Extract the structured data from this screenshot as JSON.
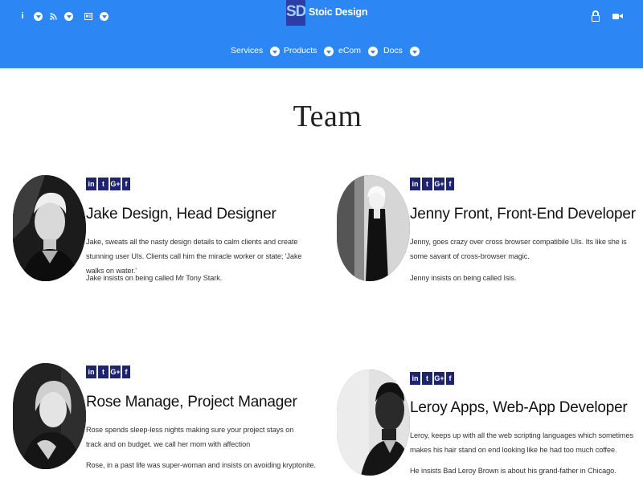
{
  "brand": {
    "logo_text": "SD",
    "name": "Stoic Design"
  },
  "top_left_icons": [
    "info-icon",
    "rss-icon",
    "id-card-icon"
  ],
  "top_right_icons": [
    "lock-icon",
    "video-camera-icon"
  ],
  "nav": [
    {
      "label": "Services"
    },
    {
      "label": "Products"
    },
    {
      "label": "eCom"
    },
    {
      "label": "Docs"
    }
  ],
  "page_title": "Team",
  "social_labels": {
    "linkedin": "in",
    "twitter": "t",
    "google": "G+",
    "facebook": "f"
  },
  "members": [
    {
      "name": "Jake Design, Head Designer",
      "bio": "Jake, sweats all the nasty design details to calm clients and create stunning user UIs. Clients call him the miracle worker or state; 'Jake walks on water.'",
      "note": "Jake insists on being called Mr Tony Stark."
    },
    {
      "name": "Jenny Front, Front-End Developer",
      "bio": "Jenny, goes crazy over cross browser compatibile UIs. Its like she is some savant of cross-browser magic.",
      "note": "Jenny insists on being called Isis."
    },
    {
      "name": "Rose Manage, Project Manager",
      "bio": "Rose spends sleep-less nights making sure your project stays on track and on budget. we call her mom with affection",
      "note": "Rose, in a past life was super-woman and insists on avoiding kryptonite."
    },
    {
      "name": "Leroy Apps, Web-App Developer",
      "bio": "Leroy, keeps up with all the web scripting languages which sometimes makes his hair stand on end looking like he had too much coffee.",
      "note": "He insists Bad Leroy Brown is about his grand-father in Chicago."
    }
  ],
  "colors": {
    "header_bg": "#2c86f3",
    "logo_bg": "#2d3ca6",
    "social_bg": "#1f2470"
  }
}
